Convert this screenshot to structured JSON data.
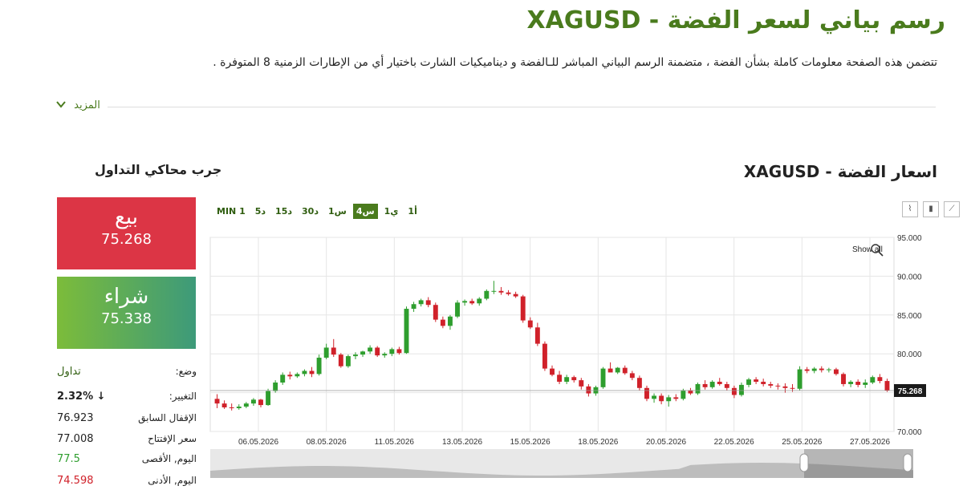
{
  "title": "رسم بياني لسعر الفضة - XAGUSD",
  "description": "تتضمن هذه الصفحة معلومات كاملة بشأن الفضة ، متضمنة الرسم البياني المباشر للـالفضة و ديناميكيات الشارت باختيار أي من الإطارات الزمنية 8 المتوفرة .",
  "more_label": "المزيد",
  "chart_heading": "اسعار الفضة - XAGUSD",
  "timeframes": [
    "MIN 1",
    "5د",
    "15د",
    "30د",
    "1س",
    "4س",
    "1ي",
    "1أ"
  ],
  "active_timeframe": "4س",
  "show_all_label": "Show all",
  "trading": {
    "title": "جرب محاكي التداول",
    "sell_label": "بيع",
    "sell_price": "75.268",
    "buy_label": "شراء",
    "buy_price": "75.338",
    "status_key": "وضع:",
    "status_value": "تداول",
    "change_key": "التغيير:",
    "change_value": "2.32% ↓",
    "prev_close_key": "الإقفال السابق",
    "prev_close_value": "76.923",
    "open_key": "سعر الإفتتاح",
    "open_value": "77.008",
    "high_key": "اليوم, الأقصى",
    "high_value": "77.5",
    "low_key": "اليوم, الأدنى",
    "low_value": "74.598"
  },
  "colors": {
    "up": "#2e9e2e",
    "down": "#d0212a",
    "brand": "#4a7b1d"
  },
  "chart_data": {
    "type": "candlestick",
    "ylim": [
      70,
      95
    ],
    "yticks": [
      "70.000",
      "75.000",
      "80.000",
      "85.000",
      "90.000",
      "95.000"
    ],
    "xticks": [
      "06.05.2026",
      "08.05.2026",
      "11.05.2026",
      "13.05.2026",
      "15.05.2026",
      "18.05.2026",
      "20.05.2026",
      "22.05.2026",
      "25.05.2026",
      "27.05.2026"
    ],
    "current_price": "75.268",
    "ohlc": [
      [
        74.2,
        74.8,
        73.0,
        73.6
      ],
      [
        73.6,
        74.0,
        72.9,
        73.1
      ],
      [
        73.1,
        73.6,
        72.7,
        73.0
      ],
      [
        73.0,
        73.5,
        72.8,
        73.2
      ],
      [
        73.2,
        73.8,
        73.0,
        73.6
      ],
      [
        73.6,
        74.3,
        73.3,
        74.1
      ],
      [
        74.1,
        74.2,
        73.1,
        73.4
      ],
      [
        73.4,
        75.5,
        73.3,
        75.2
      ],
      [
        75.2,
        76.6,
        75.0,
        76.3
      ],
      [
        76.3,
        77.6,
        76.0,
        77.3
      ],
      [
        77.3,
        77.7,
        76.7,
        77.1
      ],
      [
        77.1,
        77.6,
        76.9,
        77.4
      ],
      [
        77.4,
        78.0,
        77.1,
        77.8
      ],
      [
        77.8,
        78.3,
        77.0,
        77.4
      ],
      [
        77.4,
        79.9,
        77.2,
        79.5
      ],
      [
        79.5,
        81.3,
        79.3,
        80.8
      ],
      [
        80.8,
        81.9,
        79.6,
        79.9
      ],
      [
        79.9,
        80.1,
        78.2,
        78.4
      ],
      [
        78.4,
        79.9,
        78.2,
        79.7
      ],
      [
        79.7,
        80.2,
        79.3,
        79.9
      ],
      [
        79.9,
        80.4,
        79.6,
        80.3
      ],
      [
        80.3,
        81.1,
        80.0,
        80.8
      ],
      [
        80.8,
        81.0,
        79.6,
        79.8
      ],
      [
        79.8,
        80.2,
        79.5,
        80.0
      ],
      [
        80.0,
        80.8,
        79.7,
        80.6
      ],
      [
        80.6,
        80.9,
        79.9,
        80.1
      ],
      [
        80.1,
        86.1,
        80.0,
        85.8
      ],
      [
        85.8,
        86.7,
        85.4,
        86.4
      ],
      [
        86.4,
        87.1,
        86.1,
        86.9
      ],
      [
        86.9,
        87.3,
        86.0,
        86.3
      ],
      [
        86.3,
        86.6,
        84.1,
        84.4
      ],
      [
        84.4,
        84.8,
        83.3,
        83.6
      ],
      [
        83.6,
        85.0,
        83.1,
        84.8
      ],
      [
        84.8,
        86.9,
        84.6,
        86.6
      ],
      [
        86.6,
        87.0,
        86.2,
        86.8
      ],
      [
        86.8,
        87.1,
        86.3,
        86.5
      ],
      [
        86.5,
        87.3,
        86.2,
        87.1
      ],
      [
        87.1,
        88.3,
        86.9,
        88.1
      ],
      [
        88.1,
        89.4,
        87.7,
        88.1
      ],
      [
        88.1,
        88.6,
        87.6,
        87.9
      ],
      [
        87.9,
        88.2,
        87.5,
        87.7
      ],
      [
        87.7,
        88.0,
        87.2,
        87.4
      ],
      [
        87.4,
        87.6,
        84.0,
        84.3
      ],
      [
        84.3,
        84.7,
        83.2,
        83.4
      ],
      [
        83.4,
        84.0,
        81.0,
        81.3
      ],
      [
        81.3,
        81.6,
        77.8,
        78.1
      ],
      [
        78.1,
        78.5,
        77.1,
        77.3
      ],
      [
        77.3,
        77.8,
        76.1,
        76.4
      ],
      [
        76.4,
        77.3,
        76.1,
        77.0
      ],
      [
        77.0,
        77.2,
        76.3,
        76.6
      ],
      [
        76.6,
        76.9,
        75.4,
        75.8
      ],
      [
        75.8,
        76.1,
        74.5,
        74.9
      ],
      [
        74.9,
        75.9,
        74.6,
        75.7
      ],
      [
        75.7,
        78.3,
        75.5,
        78.1
      ],
      [
        78.1,
        78.9,
        77.7,
        77.6
      ],
      [
        77.6,
        78.3,
        77.4,
        78.2
      ],
      [
        78.2,
        78.5,
        77.3,
        77.5
      ],
      [
        77.5,
        77.8,
        76.6,
        76.9
      ],
      [
        76.9,
        77.2,
        75.3,
        75.6
      ],
      [
        75.6,
        75.9,
        73.9,
        74.2
      ],
      [
        74.2,
        74.9,
        73.7,
        74.6
      ],
      [
        74.6,
        74.9,
        73.5,
        73.9
      ],
      [
        73.9,
        74.7,
        73.2,
        74.4
      ],
      [
        74.4,
        74.8,
        73.9,
        74.2
      ],
      [
        74.2,
        75.5,
        74.0,
        75.3
      ],
      [
        75.3,
        75.6,
        74.7,
        74.9
      ],
      [
        74.9,
        76.3,
        74.7,
        76.1
      ],
      [
        76.1,
        76.6,
        75.4,
        75.7
      ],
      [
        75.7,
        76.6,
        75.5,
        76.4
      ],
      [
        76.4,
        76.9,
        75.9,
        76.1
      ],
      [
        76.1,
        76.4,
        75.3,
        75.6
      ],
      [
        75.6,
        75.9,
        74.3,
        74.7
      ],
      [
        74.7,
        76.3,
        74.5,
        76.0
      ],
      [
        76.0,
        76.9,
        75.7,
        76.7
      ],
      [
        76.7,
        77.0,
        76.1,
        76.4
      ],
      [
        76.4,
        76.8,
        75.8,
        76.1
      ],
      [
        76.1,
        76.4,
        75.6,
        75.9
      ],
      [
        75.9,
        76.2,
        75.4,
        75.8
      ],
      [
        75.8,
        76.2,
        75.0,
        75.6
      ],
      [
        75.6,
        76.1,
        75.1,
        75.5
      ],
      [
        75.5,
        78.4,
        75.3,
        78.0
      ],
      [
        78.0,
        78.3,
        77.5,
        77.8
      ],
      [
        77.8,
        78.3,
        77.5,
        78.1
      ],
      [
        78.1,
        78.4,
        77.6,
        77.9
      ],
      [
        77.9,
        78.2,
        77.6,
        78.0
      ],
      [
        78.0,
        78.2,
        77.2,
        77.4
      ],
      [
        77.4,
        77.6,
        75.8,
        76.1
      ],
      [
        76.1,
        76.6,
        75.7,
        76.4
      ],
      [
        76.4,
        76.7,
        75.7,
        76.0
      ],
      [
        76.0,
        76.7,
        75.6,
        76.3
      ],
      [
        76.3,
        77.2,
        76.1,
        77.0
      ],
      [
        77.0,
        77.4,
        76.2,
        76.5
      ],
      [
        76.5,
        76.8,
        75.1,
        75.268
      ]
    ]
  }
}
